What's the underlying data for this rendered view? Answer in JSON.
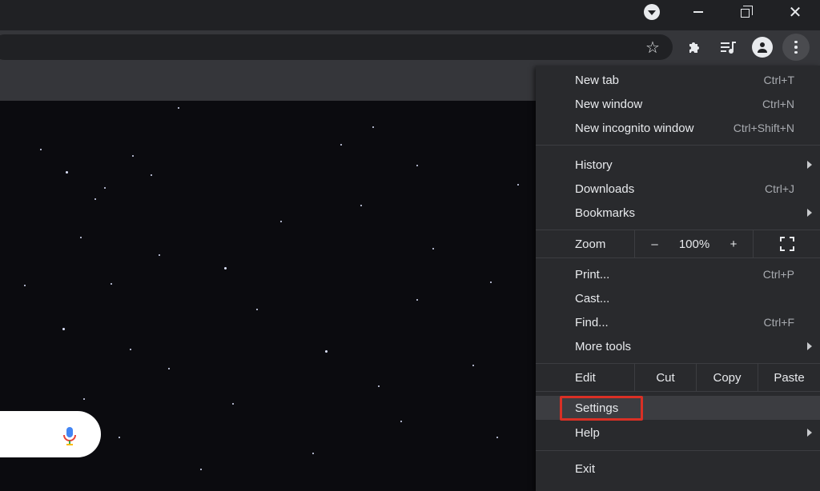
{
  "window_controls": {
    "tab_search": "tab-search-icon",
    "minimize": "minimize-icon",
    "restore": "restore-icon",
    "close": "✕"
  },
  "toolbar": {
    "bookmark_star": "☆",
    "icons": [
      "extensions-puzzle-icon",
      "media-control-icon",
      "profile-icon",
      "kebab-menu-icon"
    ]
  },
  "menu": {
    "new_tab": {
      "label": "New tab",
      "shortcut": "Ctrl+T"
    },
    "new_window": {
      "label": "New window",
      "shortcut": "Ctrl+N"
    },
    "new_incognito": {
      "label": "New incognito window",
      "shortcut": "Ctrl+Shift+N"
    },
    "history": {
      "label": "History"
    },
    "downloads": {
      "label": "Downloads",
      "shortcut": "Ctrl+J"
    },
    "bookmarks": {
      "label": "Bookmarks"
    },
    "zoom": {
      "label": "Zoom",
      "minus": "–",
      "value": "100%",
      "plus": "+"
    },
    "print": {
      "label": "Print...",
      "shortcut": "Ctrl+P"
    },
    "cast": {
      "label": "Cast..."
    },
    "find": {
      "label": "Find...",
      "shortcut": "Ctrl+F"
    },
    "more_tools": {
      "label": "More tools"
    },
    "edit": {
      "label": "Edit",
      "cut": "Cut",
      "copy": "Copy",
      "paste": "Paste"
    },
    "settings": {
      "label": "Settings"
    },
    "help": {
      "label": "Help"
    },
    "exit": {
      "label": "Exit"
    }
  },
  "colors": {
    "highlight": "#d93025",
    "menu_bg": "#292a2d",
    "page_bg": "#0b0b0f"
  }
}
